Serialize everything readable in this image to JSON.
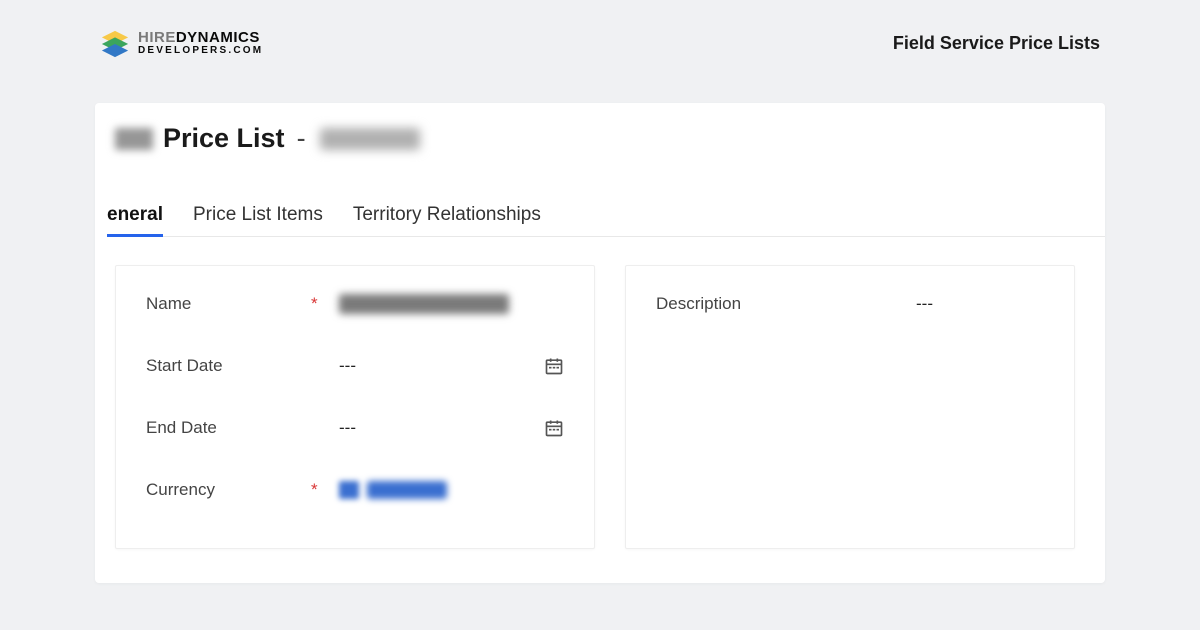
{
  "branding": {
    "logo_top_prefix": "HIRE",
    "logo_top_suffix": "DYNAMICS",
    "logo_bottom_prefix": "DEVELOPERS",
    "logo_bottom_suffix": ".COM"
  },
  "header": {
    "page_title": "Field Service Price Lists"
  },
  "record": {
    "title": "Price List",
    "title_separator": "-"
  },
  "tabs": [
    {
      "label": "eneral",
      "active": true
    },
    {
      "label": "Price List Items",
      "active": false
    },
    {
      "label": "Territory Relationships",
      "active": false
    }
  ],
  "form": {
    "left": [
      {
        "key": "name",
        "label": "Name",
        "required": true,
        "value_type": "redacted",
        "has_calendar": false
      },
      {
        "key": "start_date",
        "label": "Start Date",
        "required": false,
        "value": "---",
        "has_calendar": true
      },
      {
        "key": "end_date",
        "label": "End Date",
        "required": false,
        "value": "---",
        "has_calendar": true
      },
      {
        "key": "currency",
        "label": "Currency",
        "required": true,
        "value_type": "redacted_lookup",
        "has_calendar": false
      }
    ],
    "right": [
      {
        "key": "description",
        "label": "Description",
        "required": false,
        "value": "---"
      }
    ]
  }
}
